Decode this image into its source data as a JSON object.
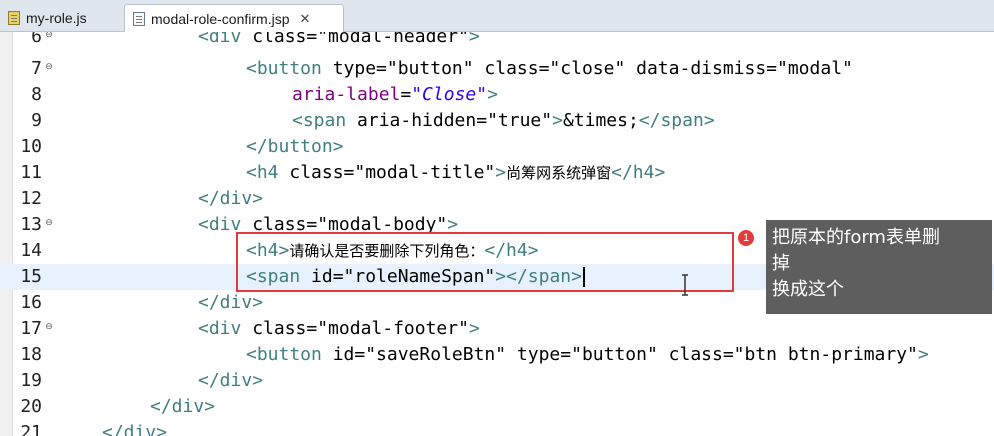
{
  "tabs": [
    {
      "label": "my-role.js",
      "icon": "js-file-icon",
      "active": false
    },
    {
      "label": "modal-role-confirm.jsp",
      "icon": "jsp-file-icon",
      "active": true,
      "close": "✕"
    }
  ],
  "editor": {
    "current_line": 15,
    "lines": [
      {
        "num": "6",
        "fold": "⊖",
        "code": "<div class=\"modal-header\">"
      },
      {
        "num": "7",
        "fold": "⊖",
        "code": "<button type=\"button\" class=\"close\" data-dismiss=\"modal\""
      },
      {
        "num": "8",
        "fold": "",
        "code": "aria-label=\"Close\">"
      },
      {
        "num": "9",
        "fold": "",
        "code": "<span aria-hidden=\"true\">&times;</span>"
      },
      {
        "num": "10",
        "fold": "",
        "code": "</button>"
      },
      {
        "num": "11",
        "fold": "",
        "code": "<h4 class=\"modal-title\">尚筹网系统弹窗</h4>"
      },
      {
        "num": "12",
        "fold": "",
        "code": "</div>"
      },
      {
        "num": "13",
        "fold": "⊖",
        "code": "<div class=\"modal-body\">"
      },
      {
        "num": "14",
        "fold": "",
        "code": "<h4>请确认是否要删除下列角色：</h4>"
      },
      {
        "num": "15",
        "fold": "",
        "code": "<span id=\"roleNameSpan\"></span>"
      },
      {
        "num": "16",
        "fold": "",
        "code": "</div>"
      },
      {
        "num": "17",
        "fold": "⊖",
        "code": "<div class=\"modal-footer\">"
      },
      {
        "num": "18",
        "fold": "",
        "code": "<button id=\"saveRoleBtn\" type=\"button\" class=\"btn btn-primary\">"
      },
      {
        "num": "19",
        "fold": "",
        "code": "</div>"
      },
      {
        "num": "20",
        "fold": "",
        "code": "</div>"
      },
      {
        "num": "21",
        "fold": "",
        "code": "</div>"
      }
    ]
  },
  "annotation": {
    "badge": "1",
    "note_lines": [
      "把原本的form表单删",
      "掉",
      "换成这个"
    ],
    "color": "#e13b3b"
  }
}
